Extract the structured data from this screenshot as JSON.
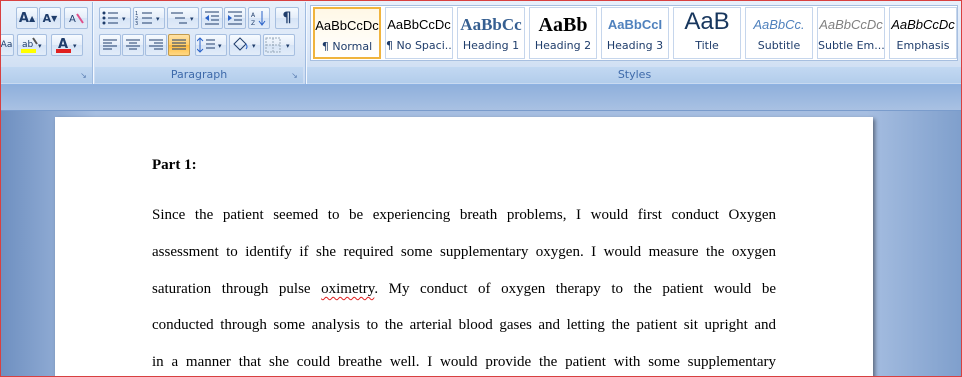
{
  "ribbon": {
    "font_group": {
      "grow_font": "A",
      "shrink_font": "A",
      "change_case": "Aa",
      "highlight_color": "#ffff00",
      "font_color": "#e02020"
    },
    "paragraph_group": {
      "label": "Paragraph",
      "show_marks": "¶"
    },
    "styles_group": {
      "label": "Styles",
      "tiles": [
        {
          "sample": "AaBbCcDc",
          "name": "¶ Normal",
          "selected": true
        },
        {
          "sample": "AaBbCcDc",
          "name": "¶ No Spaci..."
        },
        {
          "sample": "AaBbCc",
          "name": "Heading 1"
        },
        {
          "sample": "AaBb",
          "name": "Heading 2"
        },
        {
          "sample": "AaBbCcI",
          "name": "Heading 3"
        },
        {
          "sample": "AaB",
          "name": "Title"
        },
        {
          "sample": "AaBbCc.",
          "name": "Subtitle"
        },
        {
          "sample": "AaBbCcDc",
          "name": "Subtle Em..."
        },
        {
          "sample": "AaBbCcDc",
          "name": "Emphasis"
        }
      ]
    }
  },
  "document": {
    "heading": "Part 1:",
    "lines": [
      "Since the patient seemed to be experiencing breath problems, I would first conduct Oxygen",
      "assessment to identify if she required some supplementary oxygen. I would measure the oxygen",
      [
        "saturation through pulse ",
        "oximetry",
        ". My conduct of oxygen therapy to the patient would be"
      ],
      "conducted through some analysis to the arterial blood gases and letting the patient sit upright and",
      "in a manner that she could breathe well. I would provide the patient with some supplementary"
    ]
  }
}
